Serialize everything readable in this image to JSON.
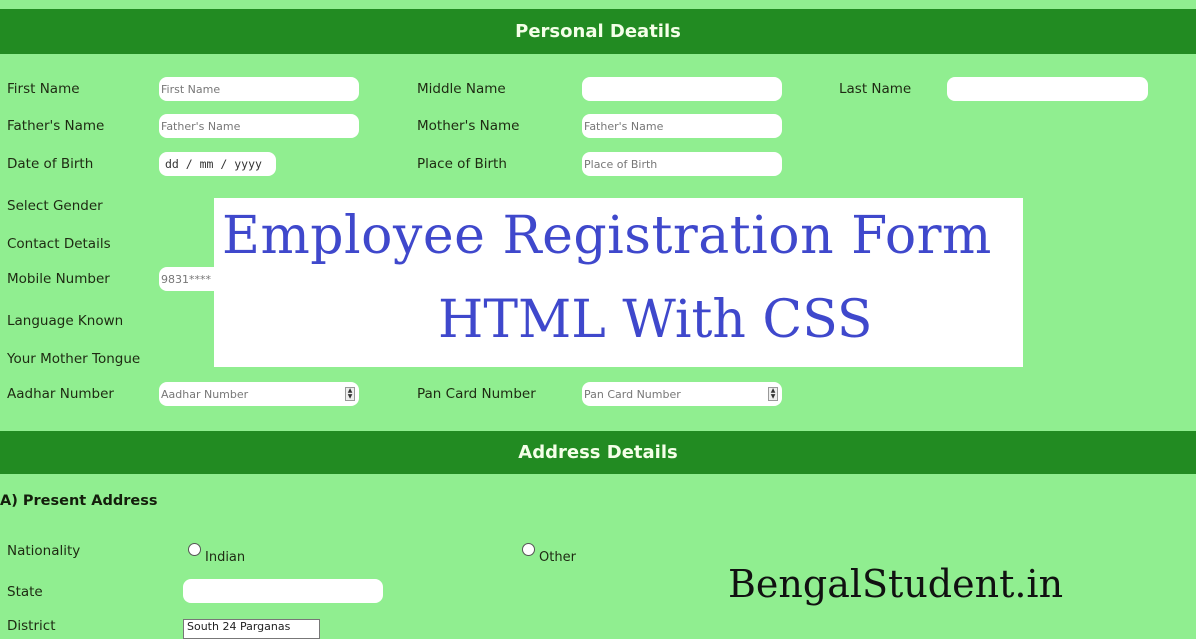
{
  "personal": {
    "header": "Personal Deatils",
    "first_name": {
      "label": "First Name",
      "placeholder": "First Name"
    },
    "middle_name": {
      "label": "Middle Name",
      "placeholder": ""
    },
    "last_name": {
      "label": "Last Name",
      "placeholder": ""
    },
    "father_name": {
      "label": "Father's Name",
      "placeholder": "Father's Name"
    },
    "mother_name": {
      "label": "Mother's Name",
      "placeholder": "Father's Name"
    },
    "dob": {
      "label": "Date of Birth",
      "placeholder": "dd / mm / yyyy"
    },
    "place_of_birth": {
      "label": "Place of Birth",
      "placeholder": "Place of Birth"
    },
    "gender": {
      "label": "Select Gender"
    },
    "contact": {
      "label": "Contact Details"
    },
    "mobile": {
      "label": "Mobile Number",
      "placeholder": "9831****"
    },
    "language": {
      "label": "Language Known"
    },
    "mother_tongue": {
      "label": "Your Mother Tongue"
    },
    "aadhar": {
      "label": "Aadhar Number",
      "placeholder": "Aadhar Number"
    },
    "pan": {
      "label": "Pan Card Number",
      "placeholder": "Pan Card Number"
    }
  },
  "banner": {
    "line1": "Employee Registration Form",
    "line2": "HTML With CSS"
  },
  "address": {
    "header": "Address Details",
    "present_title": "A) Present Address",
    "nationality": {
      "label": "Nationality",
      "options": [
        "Indian",
        "Other"
      ]
    },
    "state": {
      "label": "State",
      "placeholder": ""
    },
    "district": {
      "label": "District",
      "selected": "South 24 Parganas"
    }
  },
  "brand": "BengalStudent.in",
  "colors": {
    "background": "#90ee90",
    "header": "#228b22",
    "banner_text": "#3f48cc"
  }
}
